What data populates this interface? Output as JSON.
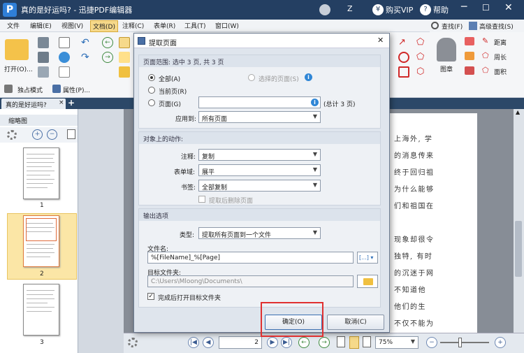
{
  "app": {
    "title": "真的是好运吗? - 迅捷PDF编辑器",
    "user_initial": "Z",
    "buy_vip": "购买VIP",
    "help": "帮助"
  },
  "menus": [
    "文件",
    "编辑(E)",
    "视图(V)",
    "文档(D)",
    "注释(C)",
    "表单(R)",
    "工具(T)",
    "窗口(W)"
  ],
  "ribbon": {
    "open": "打开(O)...",
    "exclusive_mode": "独占模式",
    "properties": "属性(P)...",
    "find": "查找(F)",
    "advanced_find": "高级查找(S)",
    "stamp": "图章",
    "distance": "距离",
    "perimeter": "周长",
    "area": "面积"
  },
  "doc_tab": {
    "label": "真的是好运吗?",
    "close": "×",
    "add": "+"
  },
  "thumbnails": {
    "title": "缩略图",
    "pages": [
      "1",
      "2",
      "3"
    ],
    "selected": "2"
  },
  "document_lines": [
    "上海外, 学",
    "的消息传来",
    "终于回归祖",
    "为什么能够",
    "们和祖国在",
    "",
    "现象却很令",
    "独特, 有时",
    "的沉迷于网",
    "不知道他",
    "他们的生",
    "不仅不能为"
  ],
  "statusbar": {
    "page_value": "2",
    "zoom": "75%"
  },
  "dialog": {
    "title": "提取页面",
    "close": "✕",
    "page_range": {
      "header": "页面范围: 选中 3 页, 共 3 页",
      "all": "全部(A)",
      "selected_pages": "选择的页面(S)",
      "current_page": "当前页(R)",
      "pages": "页面(G)",
      "pages_value": "",
      "total": "(总计 3 页)",
      "apply_to_label": "应用到:",
      "apply_to_value": "所有页面"
    },
    "actions": {
      "header": "对象上的动作:",
      "annotations_label": "注释:",
      "annotations_value": "复制",
      "form_fields_label": "表单域:",
      "form_fields_value": "展平",
      "bookmarks_label": "书签:",
      "bookmarks_value": "全部复制",
      "delete_after": "提取后删除页面"
    },
    "output": {
      "header": "输出选项",
      "type_label": "类型:",
      "type_value": "提取所有页面到一个文件",
      "filename_label": "文件名:",
      "filename_value": "%[FileName]_%[Page]",
      "macro_btn": "[...]",
      "folder_label": "目标文件夹:",
      "folder_value": "C:\\Users\\Mloong\\Documents\\",
      "open_folder": "完成后打开目标文件夹"
    },
    "ok": "确定(O)",
    "cancel": "取消(C)"
  },
  "colors": {
    "titlebar": "#243f62",
    "highlight": "#e03030",
    "active_menu": "#f6d98a"
  }
}
